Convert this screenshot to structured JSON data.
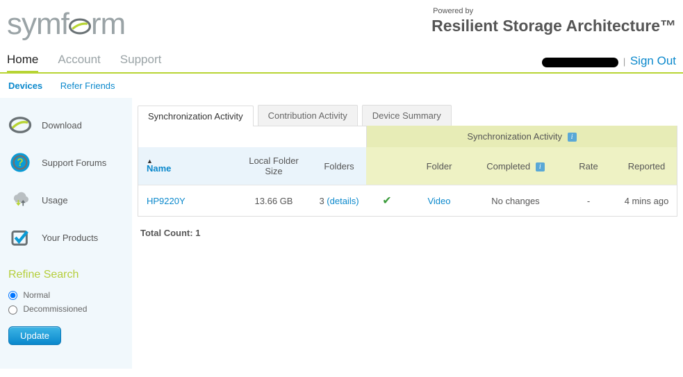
{
  "header": {
    "logo_pre": "symf",
    "logo_post": "rm",
    "powered": "Powered by",
    "arch": "Resilient Storage Architecture™"
  },
  "mainnav": {
    "home": "Home",
    "account": "Account",
    "support": "Support",
    "signout": "Sign Out"
  },
  "subnav": {
    "devices": "Devices",
    "refer": "Refer Friends"
  },
  "sidebar": {
    "items": [
      {
        "label": "Download"
      },
      {
        "label": "Support Forums"
      },
      {
        "label": "Usage"
      },
      {
        "label": "Your Products"
      }
    ]
  },
  "refine": {
    "title": "Refine Search",
    "opt_normal": "Normal",
    "opt_decom": "Decommissioned",
    "update": "Update"
  },
  "tabs": {
    "sync": "Synchronization Activity",
    "contrib": "Contribution Activity",
    "summary": "Device Summary"
  },
  "table": {
    "panel_title": "Synchronization Activity",
    "cols": {
      "name": "Name",
      "lfs": "Local Folder Size",
      "folders": "Folders",
      "folder": "Folder",
      "completed": "Completed",
      "rate": "Rate",
      "reported": "Reported"
    },
    "row": {
      "name": "HP9220Y",
      "lfs": "13.66 GB",
      "folders_count": "3",
      "folders_details": "(details)",
      "folder": "Video",
      "completed": "No changes",
      "rate": "-",
      "reported": "4 mins ago"
    },
    "total_label": "Total Count:",
    "total_value": "1"
  }
}
